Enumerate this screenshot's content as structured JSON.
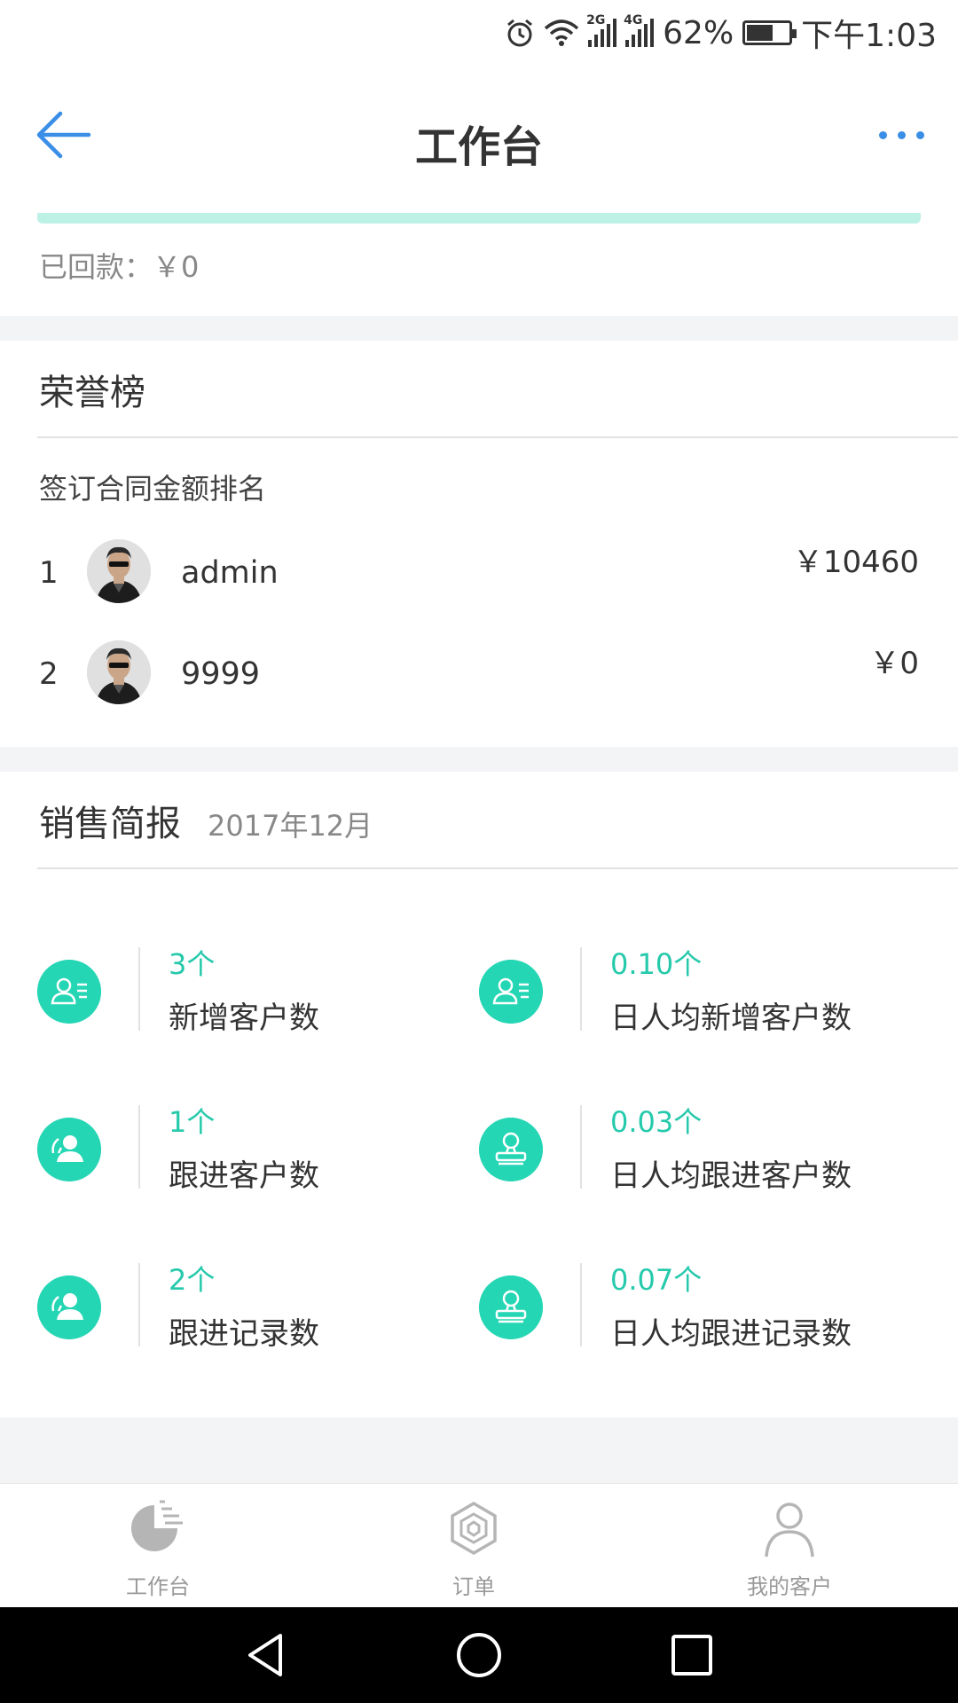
{
  "status_bar": {
    "battery_percent": "62%",
    "battery_level": 0.62,
    "time": "下午1:03",
    "net_2g": "2G",
    "net_4g": "4G"
  },
  "header": {
    "title": "工作台",
    "back_icon": "arrow-left-icon",
    "more_icon": "more-dots-icon"
  },
  "payment": {
    "returned_label": "已回款：￥0"
  },
  "honor": {
    "title": "荣誉榜",
    "subtitle": "签订合同金额排名",
    "ranks": [
      {
        "rank": "1",
        "name": "admin",
        "amount": "￥10460"
      },
      {
        "rank": "2",
        "name": "9999",
        "amount": "￥0"
      }
    ]
  },
  "sales": {
    "title": "销售简报",
    "month": "2017年12月",
    "stats": [
      {
        "value": "3个",
        "label": "新增客户数",
        "icon": "add-customer-icon"
      },
      {
        "value": "0.10个",
        "label": "日人均新增客户数",
        "icon": "add-customer-icon"
      },
      {
        "value": "1个",
        "label": "跟进客户数",
        "icon": "follow-customer-icon"
      },
      {
        "value": "0.03个",
        "label": "日人均跟进客户数",
        "icon": "stamp-icon"
      },
      {
        "value": "2个",
        "label": "跟进记录数",
        "icon": "follow-customer-icon"
      },
      {
        "value": "0.07个",
        "label": "日人均跟进记录数",
        "icon": "stamp-icon"
      }
    ]
  },
  "tabbar": {
    "items": [
      {
        "label": "工作台",
        "icon": "pie-chart-icon"
      },
      {
        "label": "订单",
        "icon": "hexagon-icon"
      },
      {
        "label": "我的客户",
        "icon": "person-icon"
      }
    ]
  },
  "colors": {
    "accent": "#25d6b5",
    "accent_text": "#25c9ab",
    "link_blue": "#3a8ee6",
    "progress": "#bdf1e6"
  }
}
